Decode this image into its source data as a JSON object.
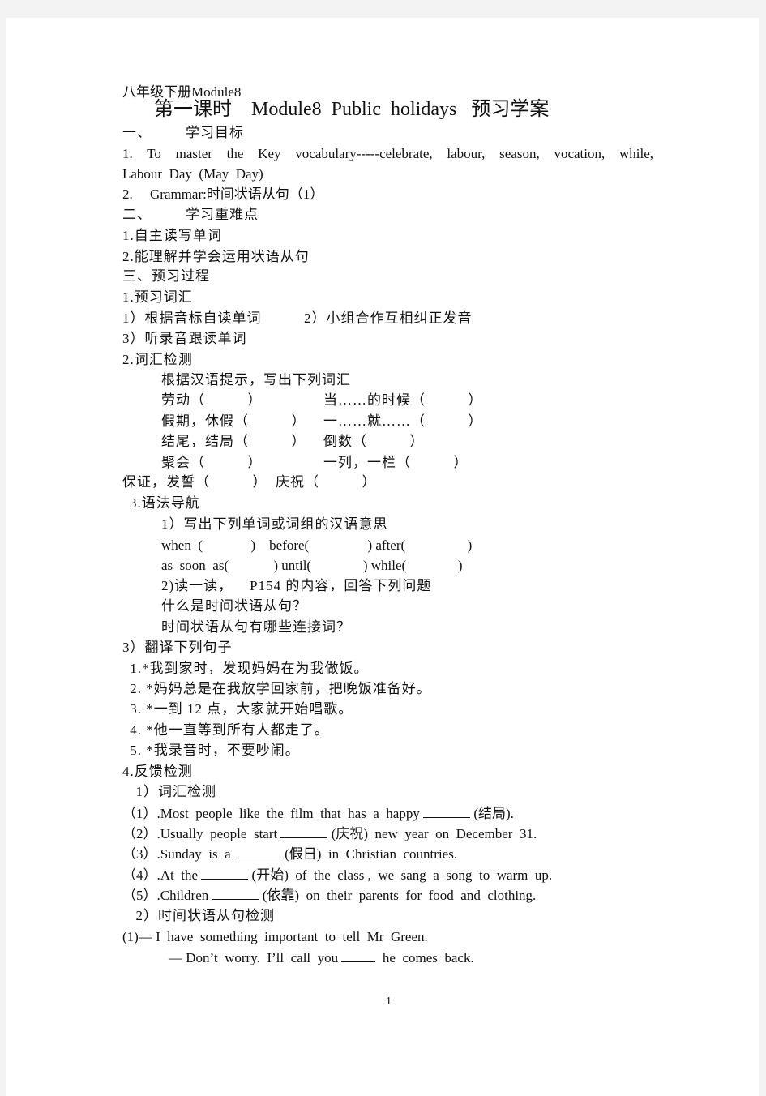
{
  "document": {
    "header": "八年级下册Module8",
    "title": "第一课时    Module8  Public  holidays   预习学案",
    "sections": {
      "s1_heading": "一、        学习目标",
      "s1_item1_line1": "1.   To  master  the  Key  vocabulary-----celebrate,  labour,  season,  vocation,  while,",
      "s1_item1_line2": "Labour  Day  (May  Day)",
      "s1_item2": "2.     Grammar:时间状语从句（1）",
      "s2_heading": "二、        学习重难点",
      "s2_item1": "1.自主读写单词",
      "s2_item2": "2.能理解并学会运用状语从句",
      "s3_heading": "三、预习过程",
      "p1_heading": "1.预习词汇",
      "p1_sub1": "1）根据音标自读单词          2）小组合作互相纠正发音",
      "p1_sub3": "3）听录音跟读单词",
      "p2_heading": "2.词汇检测",
      "p2_instruction": "根据汉语提示，写出下列词汇",
      "vocab_rows": [
        {
          "left": "劳动（          ）",
          "right": "当……的时候（          ）"
        },
        {
          "left": "假期，休假（          ）",
          "right": "一……就……（          ）"
        },
        {
          "left": "结尾，结局（          ）",
          "right": "倒数（          ）"
        },
        {
          "left": "聚会（          ）",
          "right": "一列，一栏（          ）"
        }
      ],
      "vocab_last": "保证，发誓（          ）  庆祝（          ）",
      "p3_heading": "3.语法导航",
      "p3_sub1": "1）写出下列单词或词组的汉语意思",
      "p3_words_row1": "when  (              )    before(                 ) after(                  )",
      "p3_words_row2": "as  soon  as(             ) until(               ) while(               )",
      "p3_sub2": "2)读一读，    P154 的内容，回答下列问题",
      "p3_q1": "什么是时间状语从句？",
      "p3_q2": "时间状语从句有哪些连接词？",
      "p3_sub3": "3）翻译下列句子",
      "translations": [
        " 1.*我到家时，发现妈妈在为我做饭。",
        " 2. *妈妈总是在我放学回家前，把晚饭准备好。",
        " 3. *一到 12 点，大家就开始唱歌。",
        " 4. *他一直等到所有人都走了。",
        " 5. *我录音时，不要吵闹。"
      ],
      "p4_heading": "4.反馈检测",
      "p4_sub1": "  1）词汇检测",
      "vocab_test": [
        {
          "num": "（1）",
          "before": ".Most  people  like  the  film  that  has  a  happy ",
          "hint": " (结局)."
        },
        {
          "num": "（2）",
          "before": ".Usually  people  start ",
          "hint": " (庆祝)  new  year  on  December  31."
        },
        {
          "num": "（3）",
          "before": ".Sunday  is  a ",
          "hint": " (假日)  in  Christian  countries."
        },
        {
          "num": "（4）",
          "before": ".At  the ",
          "hint": " (开始)  of  the  class ,  we  sang  a  song  to  warm  up."
        },
        {
          "num": "（5）",
          "before": ".Children ",
          "hint": " (依靠)  on  their  parents  for  food  and  clothing."
        }
      ],
      "p4_sub2": "  2）时间状语从句检测",
      "dialog_q": "(1)— I  have  something  important  to  tell  Mr  Green.",
      "dialog_a_before": "— Don’t  worry.  I’ll  call  you ",
      "dialog_a_after": "  he  comes  back."
    },
    "page_number": "1"
  }
}
